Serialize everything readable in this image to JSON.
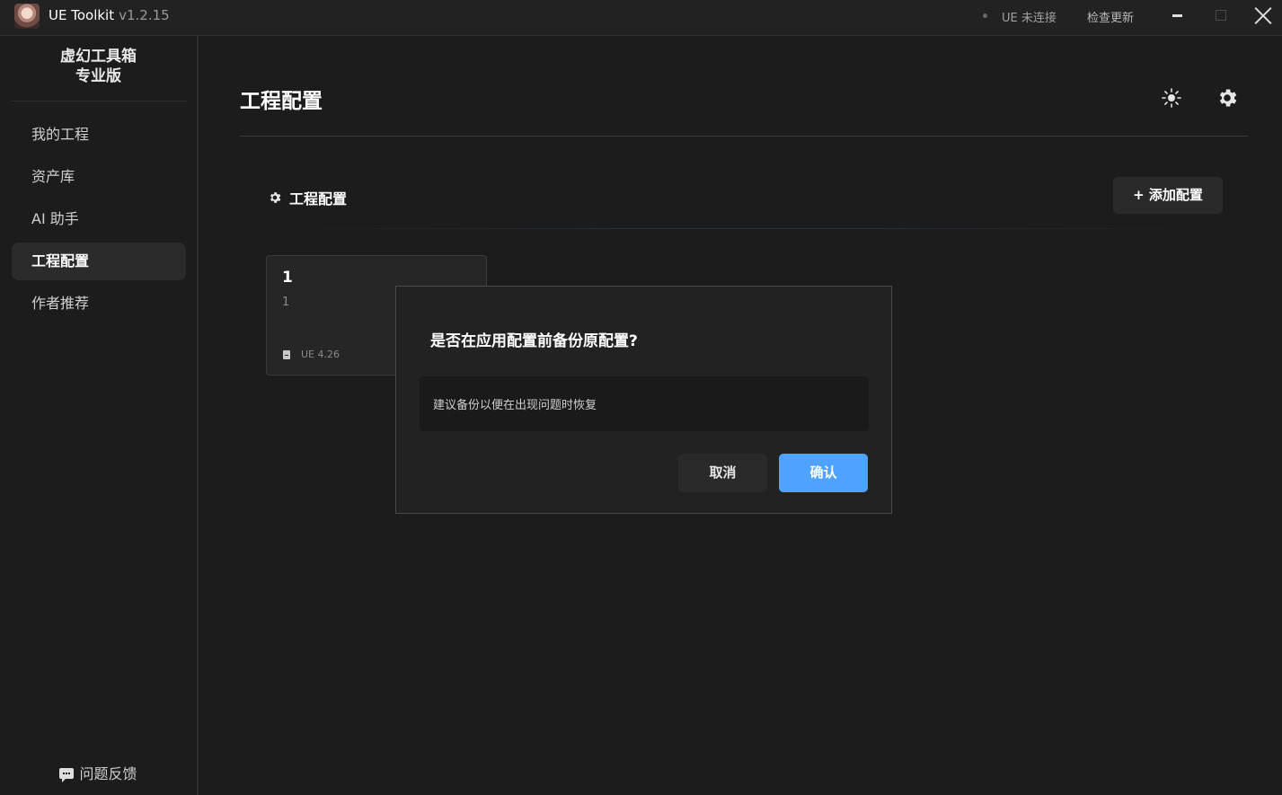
{
  "titlebar": {
    "app_name": "UE Toolkit",
    "version": "v1.2.15",
    "status": "UE 未连接",
    "check_update": "检查更新"
  },
  "sidebar": {
    "brand_line1": "虚幻工具箱",
    "brand_line2": "专业版",
    "items": [
      {
        "label": "我的工程"
      },
      {
        "label": "资产库"
      },
      {
        "label": "AI 助手"
      },
      {
        "label": "工程配置",
        "active": true
      },
      {
        "label": "作者推荐"
      }
    ],
    "feedback": "问题反馈"
  },
  "main": {
    "page_title": "工程配置",
    "section_title": "工程配置",
    "add_button": "+ 添加配置",
    "cards": [
      {
        "title": "1",
        "description": "1",
        "ue_version": "UE 4.26"
      }
    ]
  },
  "dialog": {
    "title": "是否在应用配置前备份原配置?",
    "message": "建议备份以便在出现问题时恢复",
    "cancel": "取消",
    "confirm": "确认"
  },
  "colors": {
    "background": "#1c1c1c",
    "accent": "#4da3ff",
    "panel": "#222222"
  },
  "icons": [
    "app-avatar-icon",
    "sun-icon",
    "gear-icon",
    "file-icon",
    "chat-bubble-icon",
    "close-icon",
    "minimize-icon",
    "maximize-icon"
  ]
}
